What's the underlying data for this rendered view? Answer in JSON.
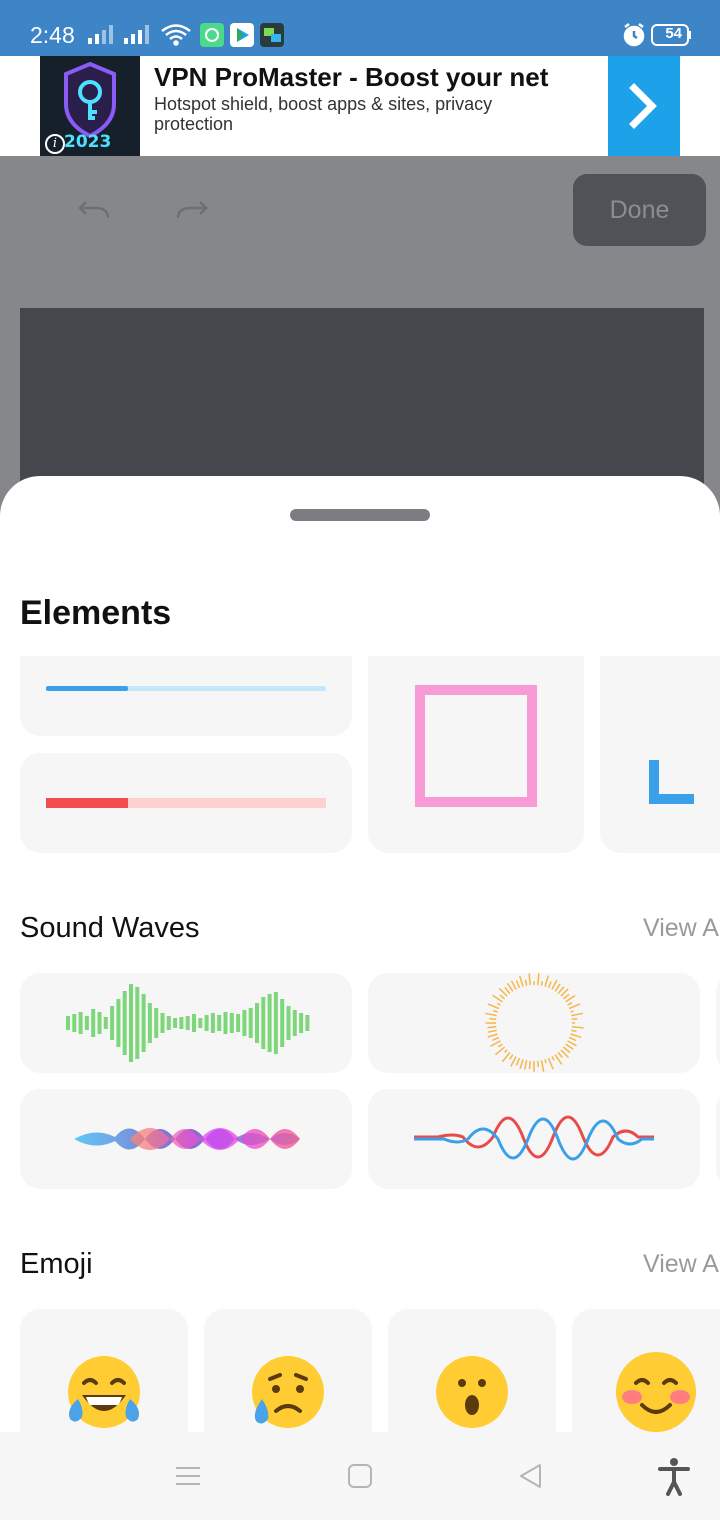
{
  "status_bar": {
    "time": "2:48",
    "battery": "54"
  },
  "ad": {
    "year": "2023",
    "info_symbol": "i",
    "title": "VPN ProMaster - Boost your net",
    "subtitle": "Hotspot shield, boost apps & sites, privacy protection"
  },
  "editor": {
    "done_label": "Done"
  },
  "sheet": {
    "title": "Elements",
    "sections": [
      {
        "title": "Sound Waves",
        "view_all": "View All"
      },
      {
        "title": "Emoji",
        "view_all": "View All"
      }
    ]
  },
  "colors": {
    "status_bar": "#3d85c6",
    "ad_arrow": "#1da1e8",
    "editor_bg": "#86878b",
    "canvas_bg": "#46474c",
    "card_bg": "#f6f6f6"
  }
}
